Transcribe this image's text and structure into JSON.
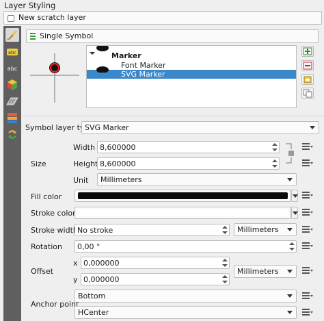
{
  "panel_title": "Layer Styling",
  "layer_selector": {
    "value": "New scratch layer"
  },
  "renderer": {
    "value": "Single Symbol"
  },
  "symbol_tree": {
    "items": [
      {
        "label": "Marker",
        "selected": false
      },
      {
        "label": "Font Marker",
        "selected": false
      },
      {
        "label": "SVG Marker",
        "selected": true
      }
    ]
  },
  "symbol_layer_type": {
    "label": "Symbol layer type",
    "value": "SVG Marker"
  },
  "size": {
    "label": "Size",
    "width_label": "Width",
    "width_value": "8,600000",
    "height_label": "Height",
    "height_value": "8,600000",
    "unit_label": "Unit",
    "unit_value": "Millimeters"
  },
  "fill_color": {
    "label": "Fill color",
    "color": "#0a0a0a"
  },
  "stroke_color": {
    "label": "Stroke color",
    "color": "#ffffff"
  },
  "stroke_width": {
    "label": "Stroke width",
    "value": "No stroke",
    "unit_value": "Millimeters"
  },
  "rotation": {
    "label": "Rotation",
    "value": "0,00 °"
  },
  "offset": {
    "label": "Offset",
    "x_label": "x",
    "x_value": "0,000000",
    "y_label": "y",
    "y_value": "0,000000",
    "unit_value": "Millimeters"
  },
  "anchor_point": {
    "label": "Anchor point",
    "vertical_value": "Bottom",
    "horizontal_value": "HCenter"
  },
  "colors": {
    "selection": "#3a87c9",
    "sidebar": "#5f5f5f"
  }
}
